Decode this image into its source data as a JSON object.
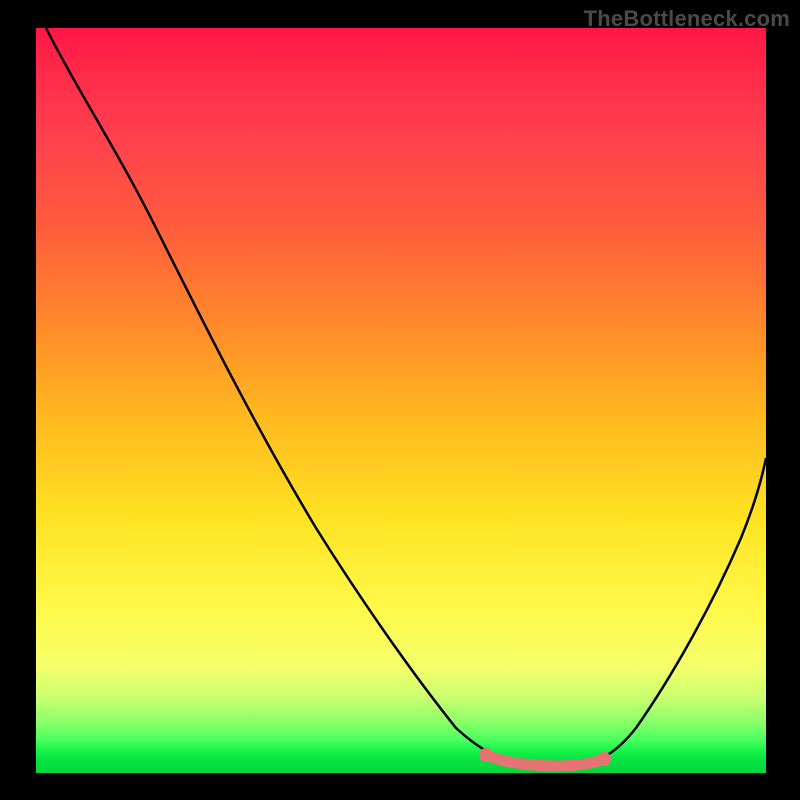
{
  "watermark": "TheBottleneck.com",
  "colors": {
    "background": "#000000",
    "curve": "#000000",
    "marker": "#e57373",
    "gradient_top": "#ff1744",
    "gradient_bottom": "#06d53c"
  },
  "chart_data": {
    "type": "line",
    "title": "",
    "xlabel": "",
    "ylabel": "",
    "x": [
      0,
      5,
      10,
      15,
      20,
      25,
      30,
      35,
      40,
      45,
      50,
      55,
      60,
      62,
      64,
      66,
      68,
      70,
      72,
      74,
      76,
      78,
      80,
      85,
      90,
      95,
      100
    ],
    "series": [
      {
        "name": "bottleneck-curve",
        "values": [
          100,
          93,
          83,
          73,
          64,
          55,
          47,
          39,
          32,
          25,
          19,
          13,
          8,
          6,
          4,
          3,
          2,
          1.5,
          1.2,
          1.0,
          1.0,
          1.3,
          2.5,
          9,
          20,
          33,
          48
        ]
      }
    ],
    "marker_range_x": [
      62,
      80
    ],
    "marker_range_y": 1.0,
    "xlim": [
      0,
      100
    ],
    "ylim": [
      0,
      100
    ],
    "grid": false,
    "annotations": []
  }
}
